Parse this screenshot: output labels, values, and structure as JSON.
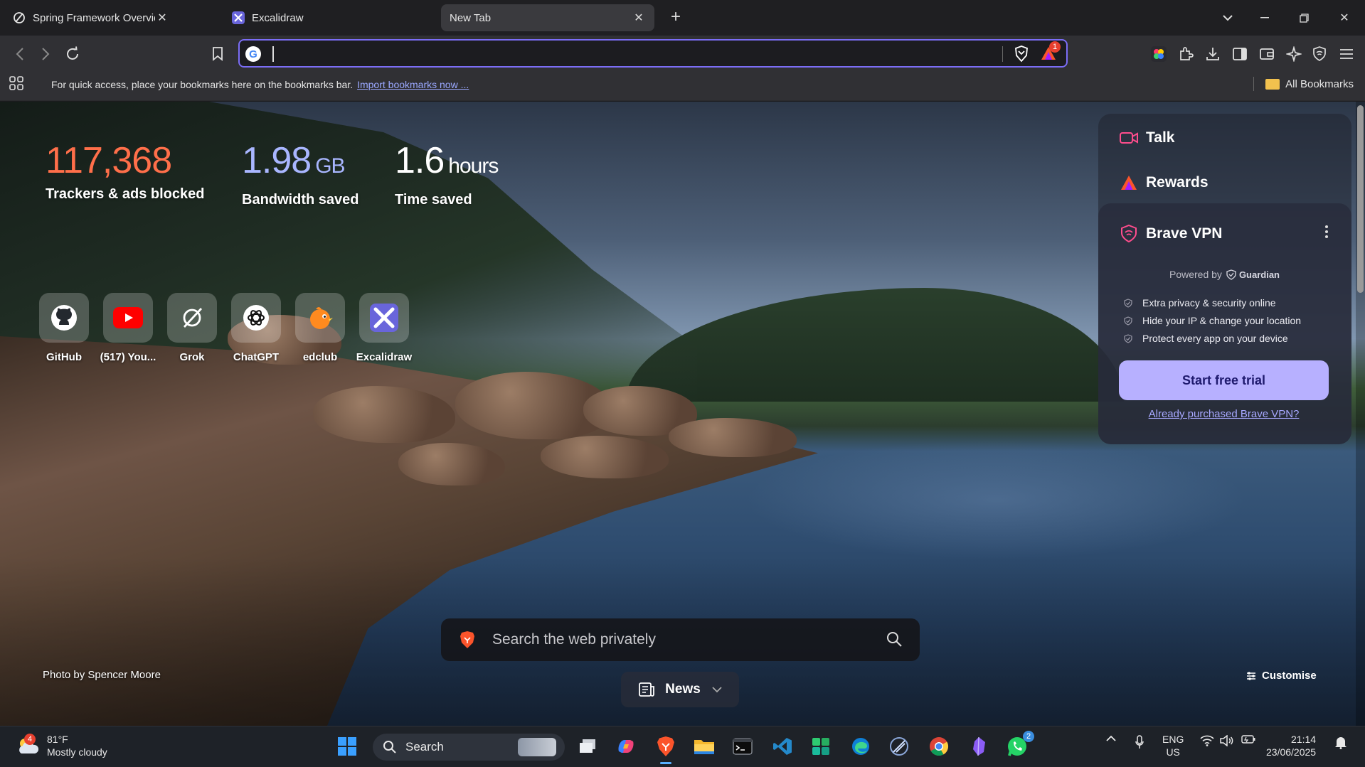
{
  "tabs": [
    {
      "title": "Spring Framework Overview in Spring",
      "favicon": "perplexity-icon"
    },
    {
      "title": "Excalidraw",
      "favicon": "excalidraw-icon"
    },
    {
      "title": "New Tab",
      "favicon": null
    }
  ],
  "address_bar": {
    "value": "",
    "search_engine_icon": "google-icon",
    "notification_count": "1"
  },
  "bookmarks_bar": {
    "message": "For quick access, place your bookmarks here on the bookmarks bar.",
    "import_link": "Import bookmarks now ...",
    "all_bookmarks": "All Bookmarks"
  },
  "stats": {
    "trackers": {
      "value": "117,368",
      "label": "Trackers & ads blocked",
      "color": "#ff6f4a"
    },
    "bandwidth": {
      "value": "1.98",
      "unit": "GB",
      "label": "Bandwidth saved",
      "color": "#a9b6ff"
    },
    "time": {
      "value": "1.6",
      "unit": "hours",
      "label": "Time saved",
      "color": "#ffffff"
    }
  },
  "top_sites": [
    {
      "name": "GitHub",
      "icon": "github-icon"
    },
    {
      "name": "(517) You...",
      "icon": "youtube-icon"
    },
    {
      "name": "Grok",
      "icon": "grok-icon"
    },
    {
      "name": "ChatGPT",
      "icon": "chatgpt-icon"
    },
    {
      "name": "edclub",
      "icon": "edclub-icon"
    },
    {
      "name": "Excalidraw",
      "icon": "excalidraw-icon"
    }
  ],
  "widgets": {
    "talk": "Talk",
    "rewards": "Rewards",
    "vpn": {
      "title": "Brave VPN",
      "powered_by": "Powered by",
      "partner": "Guardian",
      "features": [
        "Extra privacy & security online",
        "Hide your IP & change your location",
        "Protect every app on your device"
      ],
      "cta": "Start free trial",
      "purchased_link": "Already purchased Brave VPN?"
    }
  },
  "search": {
    "placeholder": "Search the web privately"
  },
  "photo_credit": "Photo by Spencer Moore",
  "news_label": "News",
  "customise_label": "Customise",
  "taskbar": {
    "weather": {
      "temp": "81°F",
      "condition": "Mostly cloudy",
      "badge": "4"
    },
    "search_label": "Search",
    "whatsapp_badge": "2",
    "language": {
      "line1": "ENG",
      "line2": "US"
    },
    "time": "21:14",
    "date": "23/06/2025"
  },
  "colors": {
    "accent": "#7b6df6",
    "vpn_button": "#b7b0ff",
    "brave_orange": "#fb542b"
  }
}
